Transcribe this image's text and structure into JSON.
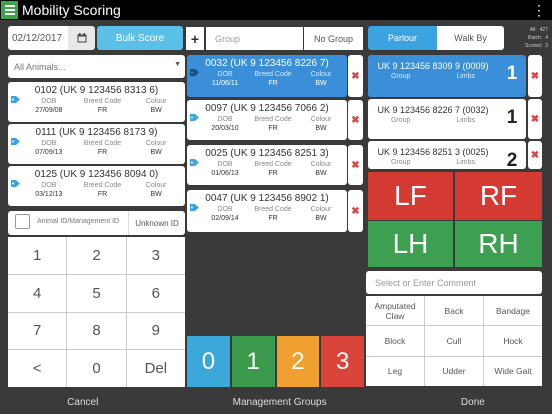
{
  "app": {
    "title": "Mobility Scoring",
    "menu_icon": "hamburger-menu-icon",
    "overflow_icon": "overflow-vertical-icon"
  },
  "controls": {
    "date_value": "02/12/2017",
    "bulk_score_label": "Bulk Score",
    "animals_select_value": "All Animals...",
    "group_placeholder": "Group",
    "no_group_label": "No Group",
    "animal_id_placeholder": "Animal ID/Management ID",
    "unknown_id_label": "Unknown ID"
  },
  "field_labels": {
    "dob": "DOB",
    "breed_code": "Breed Code",
    "colour": "Colour",
    "group": "Group",
    "limbs": "Limbs"
  },
  "left_animals": [
    {
      "eid": "0102 (UK 9 123456 8313 6)",
      "dob": "27/09/08",
      "breed": "FR",
      "colour": "BW"
    },
    {
      "eid": "0111 (UK 9 123456 8173 9)",
      "dob": "07/09/13",
      "breed": "FR",
      "colour": "BW"
    },
    {
      "eid": "0125 (UK 9 123456 8094 0)",
      "dob": "03/12/13",
      "breed": "FR",
      "colour": "BW"
    }
  ],
  "keypad": [
    "1",
    "2",
    "3",
    "4",
    "5",
    "6",
    "7",
    "8",
    "9",
    "<",
    "0",
    "Del"
  ],
  "queue": [
    {
      "eid": "0032 (UK 9 123456 8226 7)",
      "dob": "11/06/11",
      "breed": "FR",
      "colour": "BW",
      "selected": true
    },
    {
      "eid": "0097 (UK 9 123456 7066 2)",
      "dob": "20/03/10",
      "breed": "FR",
      "colour": "BW",
      "selected": false
    },
    {
      "eid": "0025 (UK 9 123456 8251 3)",
      "dob": "01/06/13",
      "breed": "FR",
      "colour": "BW",
      "selected": false
    },
    {
      "eid": "0047 (UK 9 123456 8902 1)",
      "dob": "02/09/14",
      "breed": "FR",
      "colour": "BW",
      "selected": false
    }
  ],
  "scores": [
    {
      "label": "0",
      "color": "#3aa8d8"
    },
    {
      "label": "1",
      "color": "#3c9a4c"
    },
    {
      "label": "2",
      "color": "#f0a030"
    },
    {
      "label": "3",
      "color": "#d9453b"
    }
  ],
  "tabs": {
    "parlour": "Parlour",
    "walk_by": "Walk By"
  },
  "stats": {
    "all_label": "All:",
    "all": "427",
    "batch_label": "Batch:",
    "batch": "4",
    "scored_label": "Scored:",
    "scored": "3"
  },
  "scored_list": [
    {
      "eid": "UK 9 123456 8309 9 (0009)",
      "score": "1",
      "selected": true
    },
    {
      "eid": "UK 9 123456 8226 7 (0032)",
      "score": "1",
      "selected": false
    },
    {
      "eid": "UK 9 123456 8251 3 (0025)",
      "score": "2",
      "selected": false
    }
  ],
  "limbs": [
    {
      "label": "LF",
      "color": "#d43a32"
    },
    {
      "label": "RF",
      "color": "#d43a32"
    },
    {
      "label": "LH",
      "color": "#3ca050"
    },
    {
      "label": "RH",
      "color": "#3ca050"
    }
  ],
  "comment_placeholder": "Select or Enter Comment",
  "conditions": [
    "Amputated Claw",
    "Back",
    "Bandage",
    "Block",
    "Cull",
    "Hock",
    "Leg",
    "Udder",
    "Wide Gait"
  ],
  "bottom": {
    "cancel": "Cancel",
    "management_groups": "Management Groups",
    "done": "Done"
  },
  "icons": {
    "calendar": "calendar-icon",
    "tag": "tag-icon",
    "remove": "remove-x-icon",
    "add": "plus-icon",
    "dropdown": "dropdown-caret-icon"
  },
  "colors": {
    "accent_blue": "#3aa3e0",
    "bulk_blue": "#5bc0e8",
    "menu_green": "#3aa84a",
    "remove_red": "#d44444"
  }
}
